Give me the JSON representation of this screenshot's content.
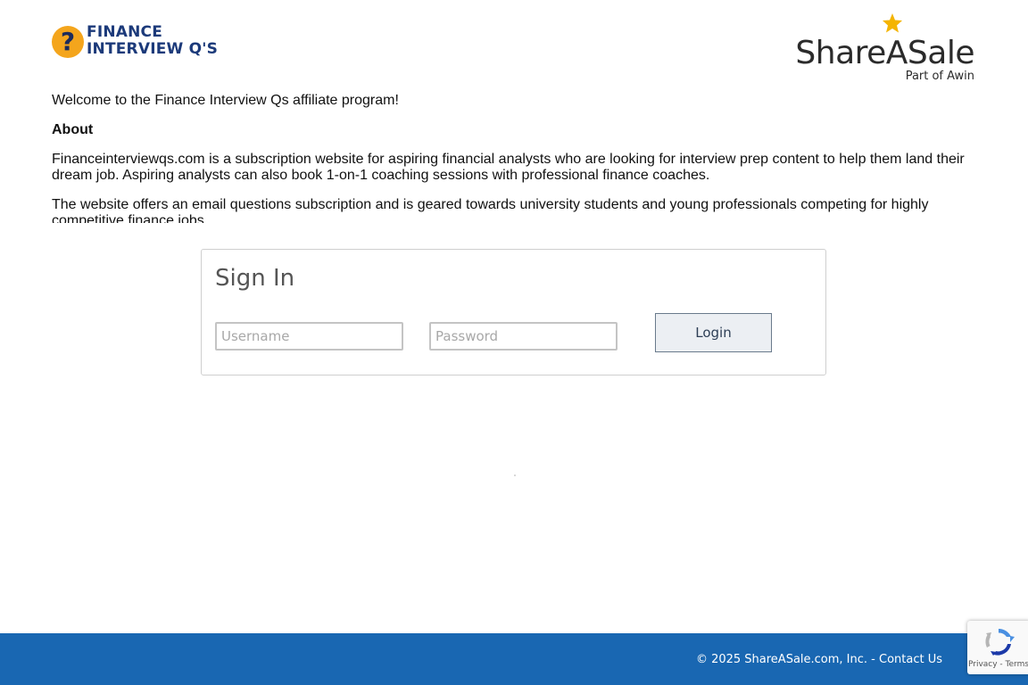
{
  "header": {
    "merchant_logo": {
      "line1": "FINANCE",
      "line2": "INTERVIEW Q'S",
      "mark": "?"
    },
    "network_logo": {
      "brand": "ShareASale",
      "sub": "Part of Awin",
      "icon": "star-icon"
    }
  },
  "description": {
    "welcome": "Welcome to the Finance Interview Qs affiliate program!",
    "about_heading": "About",
    "para1": "Financeinterviewqs.com is a subscription website for aspiring financial analysts who are looking for interview prep content to help them land their dream job. Aspiring analysts can also book 1-on-1 coaching sessions with professional finance coaches.",
    "para2": "The website offers an email questions subscription and is geared towards university students and young professionals competing for highly competitive finance jobs."
  },
  "signin": {
    "title": "Sign In",
    "username_placeholder": "Username",
    "username_value": "",
    "password_placeholder": "Password",
    "password_value": "",
    "login_label": "Login"
  },
  "footer": {
    "copyright": "© 2025 ShareASale.com, Inc. - ",
    "contact_label": "Contact Us"
  },
  "recaptcha": {
    "links": "Privacy - Terms"
  },
  "colors": {
    "footer_bg": "#1967b2",
    "merchant_orange": "#f4a51c",
    "merchant_navy": "#1c3a7a",
    "star": "#f4b400"
  }
}
